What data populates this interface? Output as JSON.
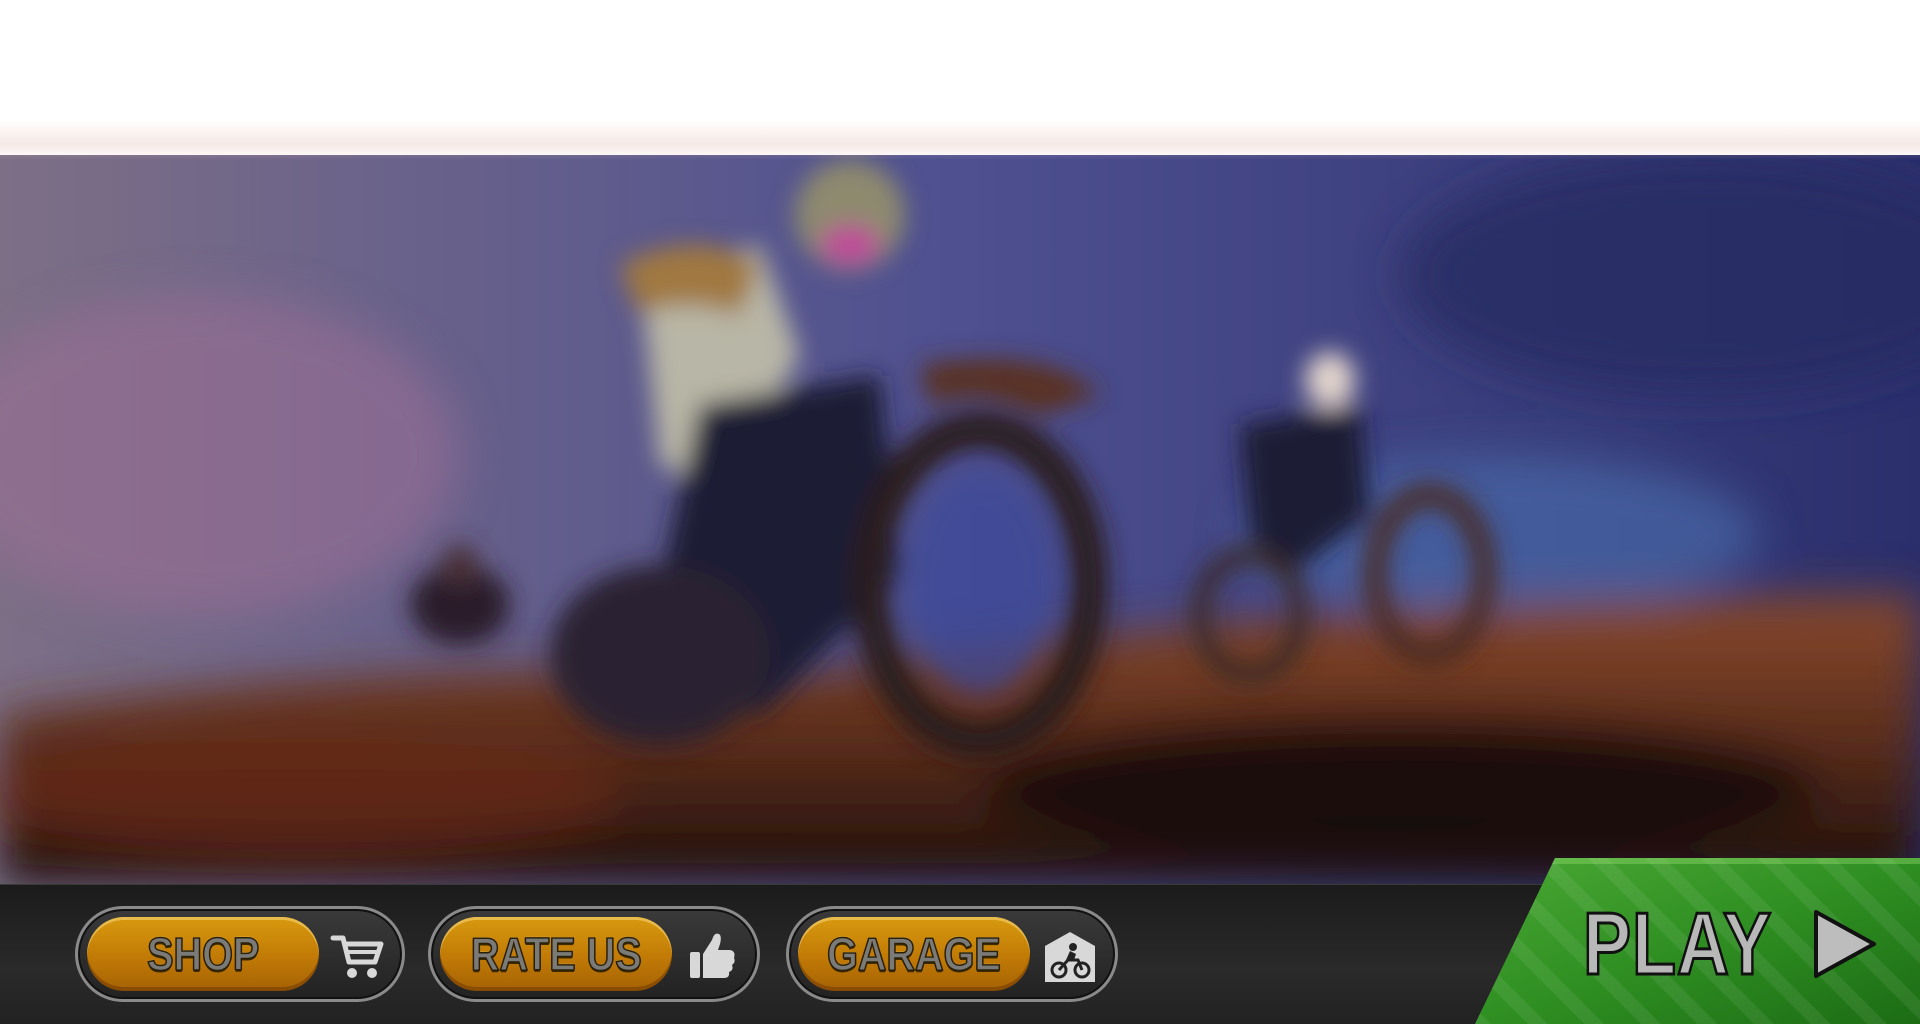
{
  "menu": {
    "shop_label": "SHOP",
    "rate_label": "RATE US",
    "garage_label": "GARAGE",
    "play_label": "PLAY"
  },
  "icons": {
    "shop": "shopping-cart-icon",
    "rate": "thumbs-up-icon",
    "garage": "garage-motorbike-icon",
    "play": "play-triangle-icon"
  },
  "colors": {
    "button_orange": "#c47f08",
    "play_green": "#3b9a25",
    "bar_dark": "#222222"
  }
}
